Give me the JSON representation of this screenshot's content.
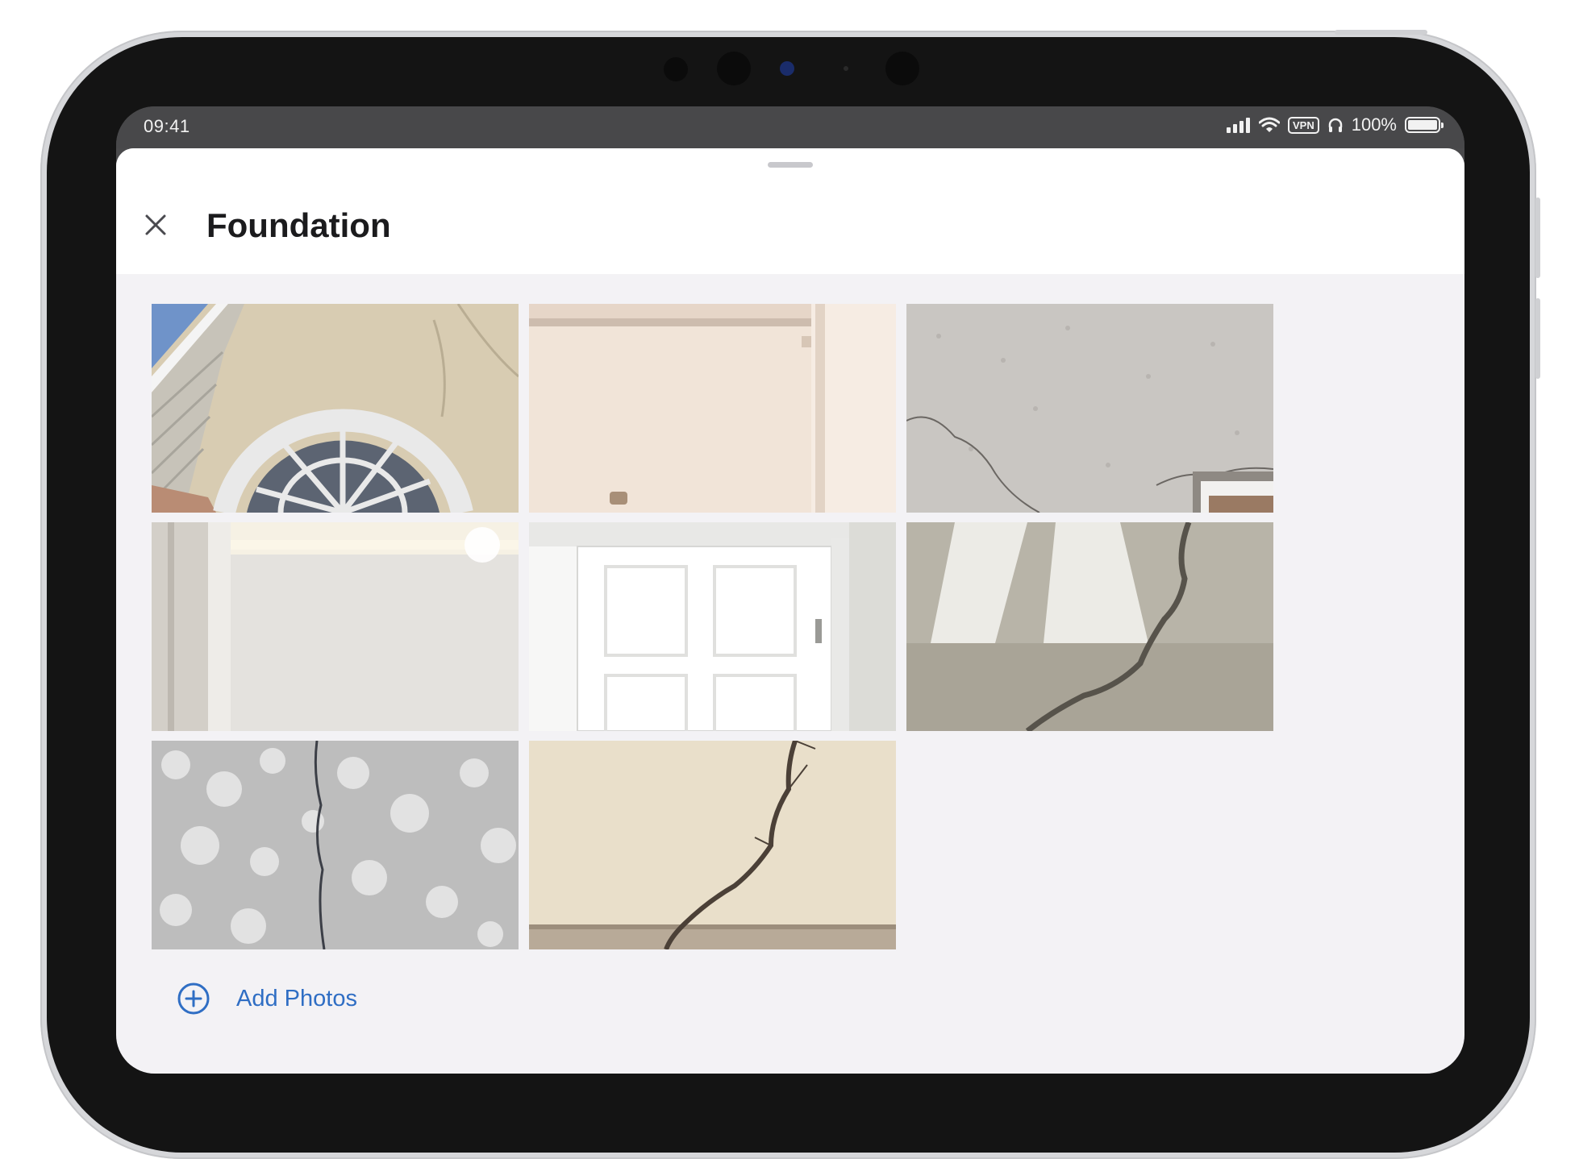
{
  "status_bar": {
    "time": "09:41",
    "vpn_label": "VPN",
    "battery_percent": "100%",
    "icons": [
      "cellular-signal-icon",
      "wifi-icon",
      "vpn-icon",
      "headphones-icon",
      "battery-icon"
    ]
  },
  "sheet": {
    "title": "Foundation",
    "close_icon": "close-icon"
  },
  "photos": [
    {
      "subject": "house-gable-arched-window"
    },
    {
      "subject": "interior-wall-corner"
    },
    {
      "subject": "stucco-wall-crack"
    },
    {
      "subject": "wall-panel-light"
    },
    {
      "subject": "white-panel-door"
    },
    {
      "subject": "concrete-floor-crack"
    },
    {
      "subject": "textured-wall-vertical-crack"
    },
    {
      "subject": "drywall-diagonal-crack"
    }
  ],
  "add_photos": {
    "label": "Add Photos",
    "icon": "add-circle-icon"
  },
  "colors": {
    "accent": "#2f6ec4",
    "sheet_background": "#f3f2f5",
    "header_background": "#ffffff",
    "device_frame": "#141414"
  }
}
